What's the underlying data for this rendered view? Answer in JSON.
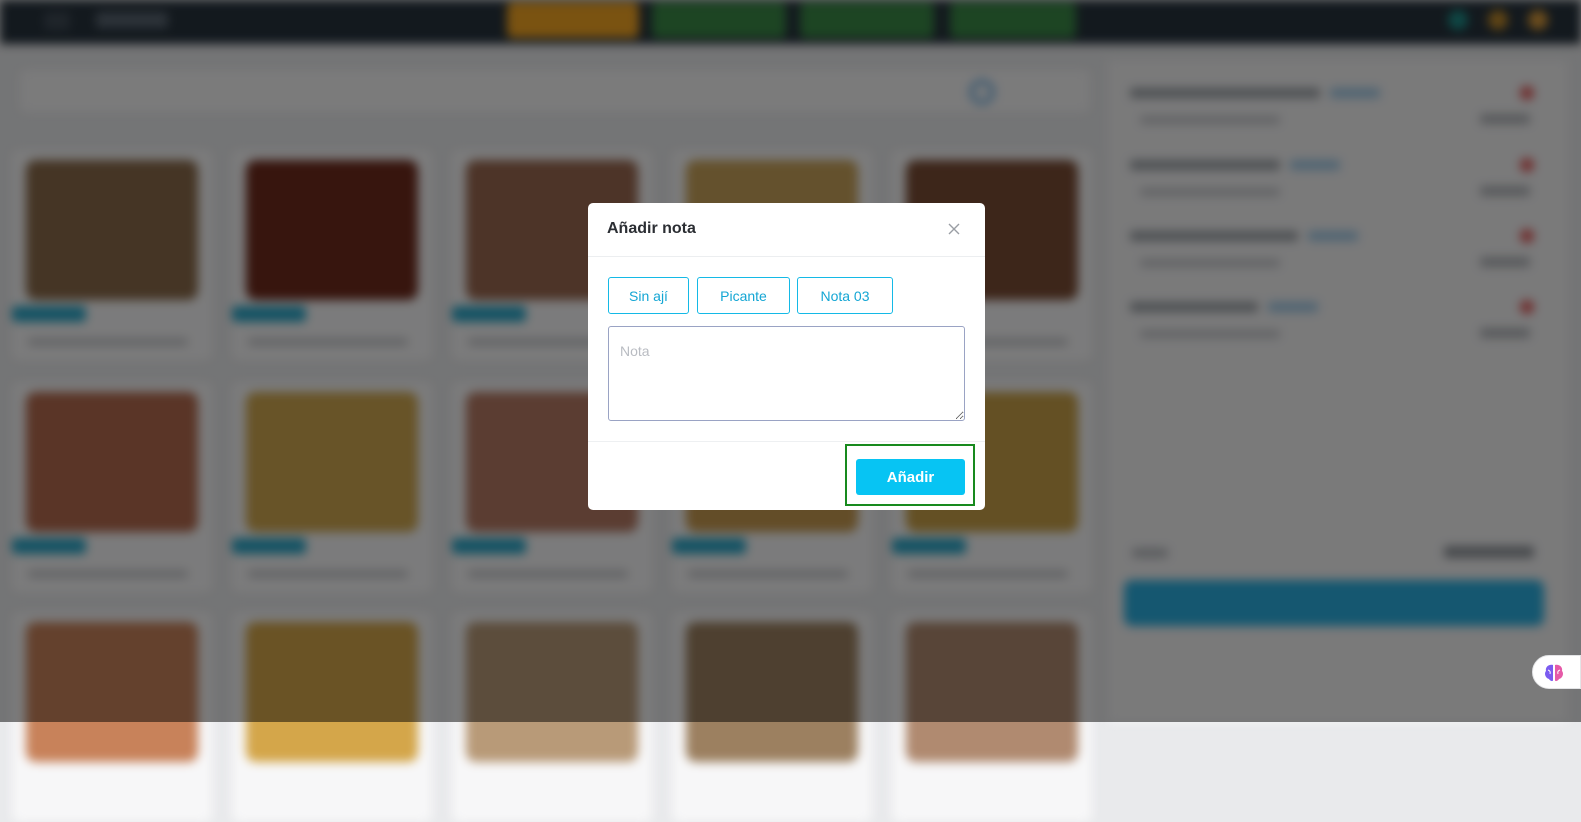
{
  "modal": {
    "title": "Añadir nota",
    "close_icon": "close-icon",
    "quick_notes": [
      "Sin ají",
      "Picante",
      "Nota 03"
    ],
    "note_placeholder": "Nota",
    "note_value": "",
    "add_label": "Añadir"
  },
  "assistant_fab": {
    "icon": "brain-icon"
  },
  "colors": {
    "accent": "#07c4f3",
    "chip_border": "#14b9e6",
    "topbar": "#26323c",
    "highlight": "#188a1e"
  }
}
